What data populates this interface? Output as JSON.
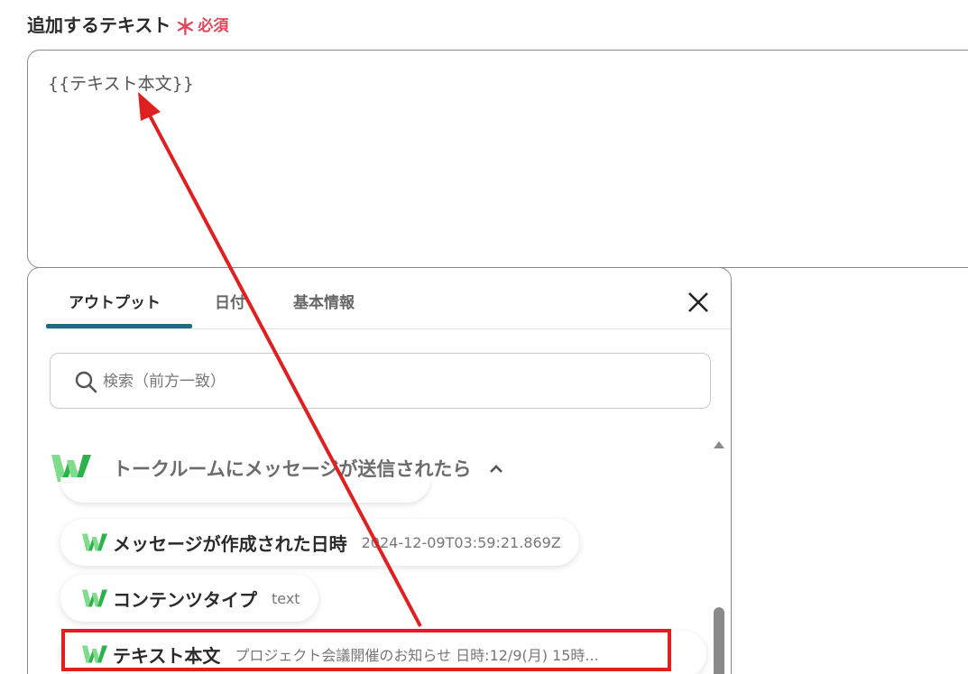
{
  "field": {
    "label": "追加するテキスト",
    "required_mark": "＊",
    "required_text": "必須",
    "value": "{{テキスト本文}}"
  },
  "panel": {
    "tabs": [
      {
        "label": "アウトプット",
        "active": true
      },
      {
        "label": "日付",
        "active": false
      },
      {
        "label": "基本情報",
        "active": false
      }
    ],
    "search_placeholder": "検索（前方一致）",
    "group": {
      "title": "トークルームにメッセージが送信されたら",
      "items": [
        {
          "label": "メッセージが作成された日時",
          "value": "2024-12-09T03:59:21.869Z"
        },
        {
          "label": "コンテンツタイプ",
          "value": "text"
        },
        {
          "label": "テキスト本文",
          "value": "プロジェクト会議開催のお知らせ 日時:12/9(月) 15時..."
        }
      ]
    }
  },
  "colors": {
    "accent": "#1f6b82",
    "required": "#e0465a",
    "annotation": "#e02020",
    "logo_green": "#2bb34a"
  }
}
